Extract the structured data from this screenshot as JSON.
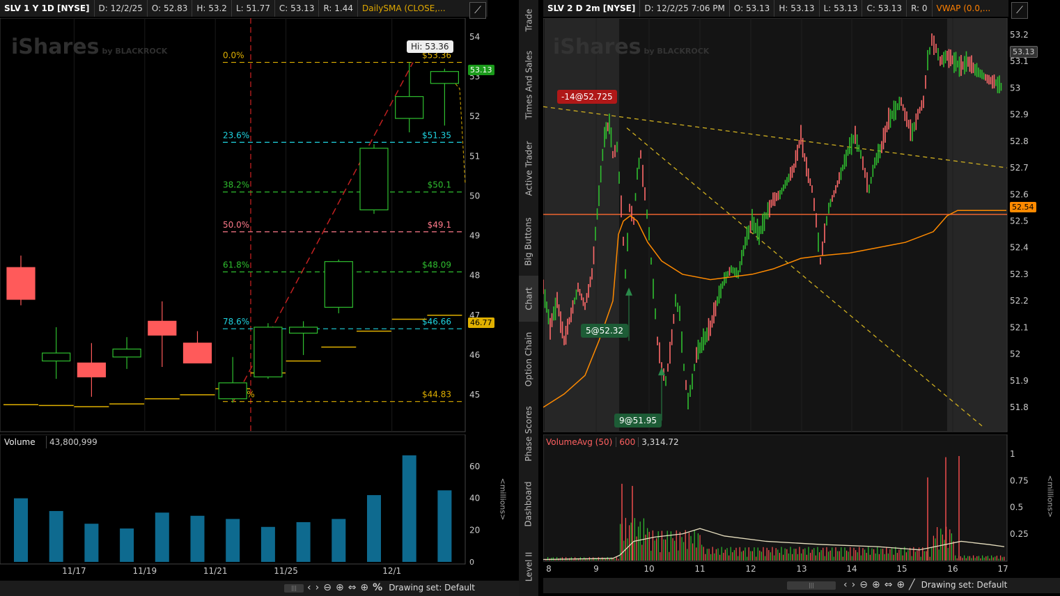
{
  "left_chart": {
    "header": {
      "symbol": "SLV 1 Y 1D [NYSE]",
      "date": "D: 12/2/25",
      "open": "O: 52.83",
      "high": "H: 53.2",
      "low": "L: 51.77",
      "close": "C: 53.13",
      "range": "R: 1.44",
      "study": "DailySMA (CLOSE,..."
    },
    "watermark": "iShares",
    "watermark_sub": "by BLACKROCK",
    "price_axis": [
      "54",
      "53",
      "52",
      "51",
      "50",
      "49",
      "48",
      "47",
      "46",
      "45"
    ],
    "hi_bubble": "Hi: 53.36",
    "last_price": "53.13",
    "sma_price": "46.77",
    "fib": [
      {
        "pct": "0.0%",
        "price": "$53.36",
        "color": "#e0b000"
      },
      {
        "pct": "23.6%",
        "price": "$51.35",
        "color": "#1fd3e0"
      },
      {
        "pct": "38.2%",
        "price": "$50.1",
        "color": "#2fbf2f"
      },
      {
        "pct": "50.0%",
        "price": "$49.1",
        "color": "#ff7a8a"
      },
      {
        "pct": "61.8%",
        "price": "$48.09",
        "color": "#2fbf2f"
      },
      {
        "pct": "78.6%",
        "price": "$46.66",
        "color": "#1fd3e0"
      },
      {
        "pct": "100.0%",
        "price": "$44.83",
        "color": "#e0b000"
      }
    ],
    "candles": [
      {
        "o": 48.2,
        "h": 48.5,
        "l": 47.25,
        "c": 47.4
      },
      {
        "o": 45.85,
        "h": 46.7,
        "l": 45.4,
        "c": 46.05
      },
      {
        "o": 45.8,
        "h": 46.3,
        "l": 44.95,
        "c": 45.45
      },
      {
        "o": 45.95,
        "h": 46.45,
        "l": 45.65,
        "c": 46.15
      },
      {
        "o": 46.85,
        "h": 47.35,
        "l": 45.7,
        "c": 46.5
      },
      {
        "o": 46.3,
        "h": 46.6,
        "l": 45.8,
        "c": 45.8
      },
      {
        "o": 44.9,
        "h": 45.95,
        "l": 44.8,
        "c": 45.3
      },
      {
        "o": 45.45,
        "h": 46.8,
        "l": 45.4,
        "c": 46.7
      },
      {
        "o": 46.55,
        "h": 46.85,
        "l": 46.0,
        "c": 46.7
      },
      {
        "o": 47.2,
        "h": 48.4,
        "l": 47.05,
        "c": 48.35
      },
      {
        "o": 49.65,
        "h": 51.3,
        "l": 49.55,
        "c": 51.2
      },
      {
        "o": 51.95,
        "h": 53.36,
        "l": 51.6,
        "c": 52.5
      },
      {
        "o": 52.83,
        "h": 53.2,
        "l": 51.77,
        "c": 53.13
      }
    ],
    "sma": [
      44.75,
      44.73,
      44.7,
      44.77,
      44.9,
      45.0,
      45.15,
      45.55,
      45.85,
      46.2,
      46.6,
      46.9,
      47.0
    ],
    "x_axis": [
      "11/17",
      "11/19",
      "11/21",
      "11/25",
      "12/1"
    ],
    "volume_title": "Volume",
    "volume_value": "43,800,999",
    "volume_axis": [
      "60",
      "40",
      "20"
    ],
    "volumes": [
      40,
      32,
      24,
      21,
      31,
      29,
      27,
      22,
      25,
      27,
      42,
      67,
      45
    ],
    "millions_label": "<millions>",
    "drawing_set": "Drawing set: Default",
    "colors": {
      "up": "#2fbf2f",
      "down": "#ff5a5a",
      "volume": "#0e6a8f",
      "sma": "#e0b000"
    }
  },
  "right_chart": {
    "header": {
      "symbol": "SLV 2 D 2m [NYSE]",
      "date": "D: 12/2/25 7:06 PM",
      "open": "O: 53.13",
      "high": "H: 53.13",
      "low": "L: 53.13",
      "close": "C: 53.13",
      "range": "R: 0",
      "study": "VWAP (0.0,..."
    },
    "watermark": "iShares",
    "watermark_sub": "by BLACKROCK",
    "price_axis": [
      "53.2",
      "53.1",
      "53",
      "52.9",
      "52.8",
      "52.7",
      "52.6",
      "52.5",
      "52.4",
      "52.3",
      "52.2",
      "52.1",
      "52",
      "51.9",
      "51.8"
    ],
    "last_price": "53.13",
    "vwap_price": "52.54",
    "trades": [
      {
        "label": "-14@52.725",
        "color": "#b01818"
      },
      {
        "label": "5@52.32",
        "color": "#1d5c36"
      },
      {
        "label": "9@51.95",
        "color": "#1d5c36"
      }
    ],
    "x_axis": [
      "8",
      "9",
      "10",
      "11",
      "12",
      "13",
      "14",
      "15",
      "16",
      "17"
    ],
    "volume_title": "VolumeAvg (50)",
    "volume_len": "600",
    "volume_value": "3,314.72",
    "volume_axis": [
      "1",
      "0.75",
      "0.5",
      "0.25"
    ],
    "millions_label": "<millions>",
    "drawing_set": "Drawing set: Default",
    "colors": {
      "vwap": "#ff8a00",
      "hline": "#ff6a30",
      "fan": "#d0b020"
    }
  },
  "side_tabs": [
    "Trade",
    "Times And Sales",
    "Active Trader",
    "Big Buttons",
    "Chart",
    "Option Chain",
    "Phase Scores",
    "Dashboard",
    "Level II"
  ],
  "active_tab": "Chart"
}
